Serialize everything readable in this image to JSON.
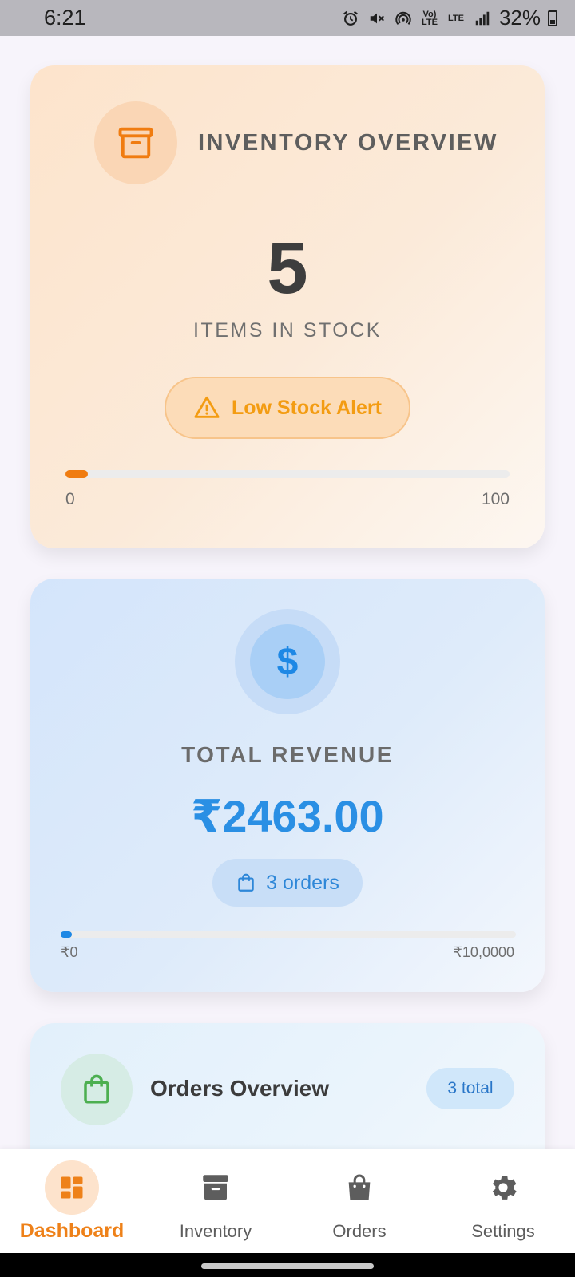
{
  "status_bar": {
    "time": "6:21",
    "icons": [
      "alarm-icon",
      "mute-icon",
      "hotspot-icon",
      "volte-icon",
      "lte-icon",
      "signal-icon"
    ],
    "volte_label": "Vo) LTE",
    "lte_label": "LTE",
    "battery": "32%"
  },
  "inventory_card": {
    "icon": "archive-box-icon",
    "title": "INVENTORY OVERVIEW",
    "count": "5",
    "subtitle": "ITEMS IN STOCK",
    "alert_label": "Low Stock Alert",
    "progress": {
      "value": 5,
      "min": 0,
      "max": 100
    },
    "min_label": "0",
    "max_label": "100"
  },
  "revenue_card": {
    "icon": "dollar-icon",
    "icon_glyph": "$",
    "title": "TOTAL REVENUE",
    "amount": "₹2463.00",
    "orders_label": "3 orders",
    "progress": {
      "value": 2463,
      "min": 0,
      "max": 100000
    },
    "min_label": "₹0",
    "max_label": "₹10,0000"
  },
  "orders_card": {
    "icon": "shopping-bag-icon",
    "title": "Orders Overview",
    "badge": "3 total"
  },
  "bottom_nav": {
    "items": [
      {
        "label": "Dashboard",
        "icon": "dashboard-icon",
        "active": true
      },
      {
        "label": "Inventory",
        "icon": "archive-box-icon",
        "active": false
      },
      {
        "label": "Orders",
        "icon": "shopping-bag-icon",
        "active": false
      },
      {
        "label": "Settings",
        "icon": "gear-icon",
        "active": false
      }
    ]
  },
  "colors": {
    "inventory_accent": "#f07c10",
    "alert_text": "#f39c12",
    "revenue_accent": "#1e88e5",
    "orders_accent": "#4caf50",
    "nav_active": "#ee8119"
  }
}
